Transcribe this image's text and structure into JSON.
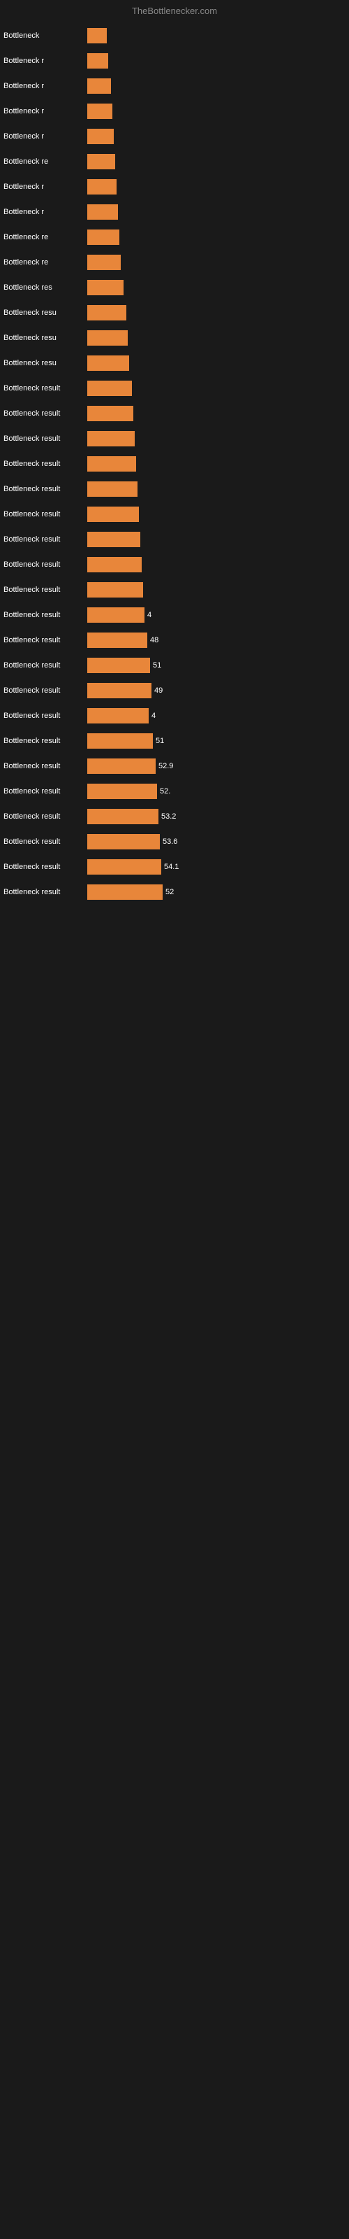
{
  "header": {
    "title": "TheBottlenecker.com"
  },
  "bars": [
    {
      "label": "Bottleneck",
      "value": null,
      "width": 28
    },
    {
      "label": "Bottleneck r",
      "value": null,
      "width": 30
    },
    {
      "label": "Bottleneck r",
      "value": null,
      "width": 34
    },
    {
      "label": "Bottleneck r",
      "value": null,
      "width": 36
    },
    {
      "label": "Bottleneck r",
      "value": null,
      "width": 38
    },
    {
      "label": "Bottleneck re",
      "value": null,
      "width": 40
    },
    {
      "label": "Bottleneck r",
      "value": null,
      "width": 42
    },
    {
      "label": "Bottleneck r",
      "value": null,
      "width": 44
    },
    {
      "label": "Bottleneck re",
      "value": null,
      "width": 46
    },
    {
      "label": "Bottleneck re",
      "value": null,
      "width": 48
    },
    {
      "label": "Bottleneck res",
      "value": null,
      "width": 52
    },
    {
      "label": "Bottleneck resu",
      "value": null,
      "width": 56
    },
    {
      "label": "Bottleneck resu",
      "value": null,
      "width": 58
    },
    {
      "label": "Bottleneck resu",
      "value": null,
      "width": 60
    },
    {
      "label": "Bottleneck result",
      "value": null,
      "width": 64
    },
    {
      "label": "Bottleneck result",
      "value": null,
      "width": 66
    },
    {
      "label": "Bottleneck result",
      "value": null,
      "width": 68
    },
    {
      "label": "Bottleneck result",
      "value": null,
      "width": 70
    },
    {
      "label": "Bottleneck result",
      "value": null,
      "width": 72
    },
    {
      "label": "Bottleneck result",
      "value": null,
      "width": 74
    },
    {
      "label": "Bottleneck result",
      "value": null,
      "width": 76
    },
    {
      "label": "Bottleneck result",
      "value": null,
      "width": 78
    },
    {
      "label": "Bottleneck result",
      "value": null,
      "width": 80
    },
    {
      "label": "Bottleneck result",
      "value": "4",
      "width": 82
    },
    {
      "label": "Bottleneck result",
      "value": "48",
      "width": 86
    },
    {
      "label": "Bottleneck result",
      "value": "51",
      "width": 90
    },
    {
      "label": "Bottleneck result",
      "value": "49",
      "width": 92
    },
    {
      "label": "Bottleneck result",
      "value": "4",
      "width": 88
    },
    {
      "label": "Bottleneck result",
      "value": "51",
      "width": 94
    },
    {
      "label": "Bottleneck result",
      "value": "52.9",
      "width": 98
    },
    {
      "label": "Bottleneck result",
      "value": "52.",
      "width": 100
    },
    {
      "label": "Bottleneck result",
      "value": "53.2",
      "width": 102
    },
    {
      "label": "Bottleneck result",
      "value": "53.6",
      "width": 104
    },
    {
      "label": "Bottleneck result",
      "value": "54.1",
      "width": 106
    },
    {
      "label": "Bottleneck result",
      "value": "52",
      "width": 108
    }
  ]
}
